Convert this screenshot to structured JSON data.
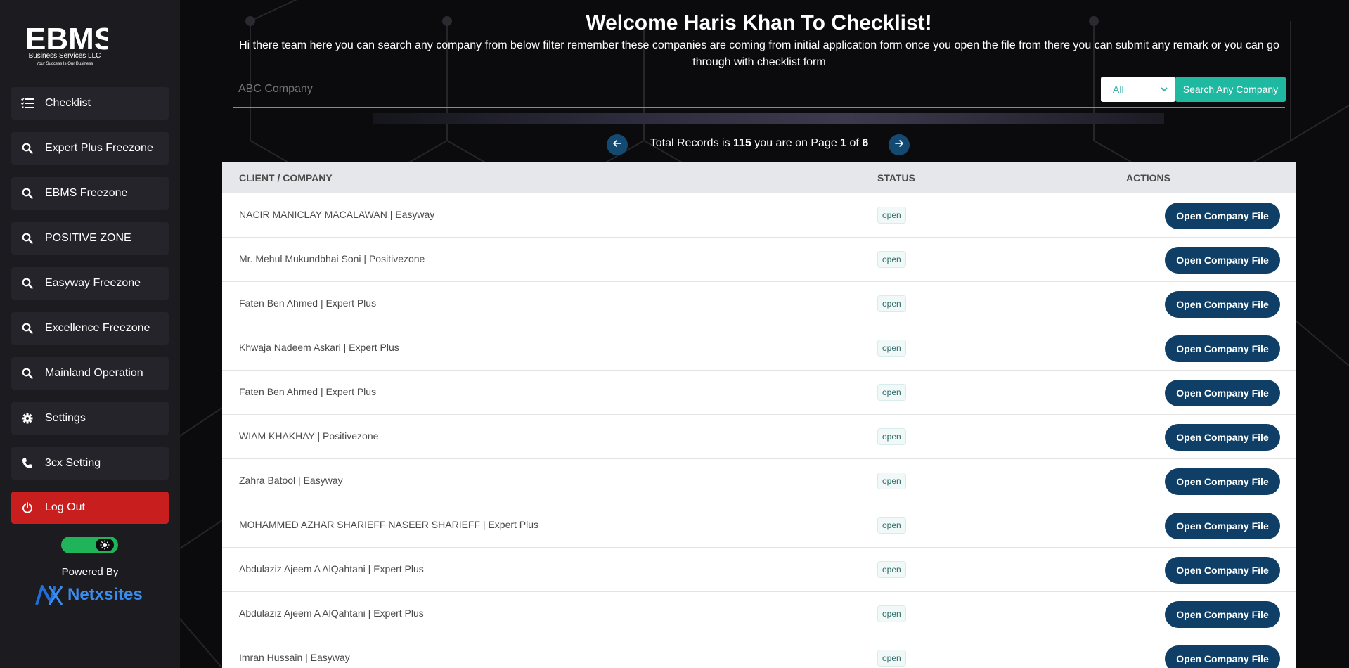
{
  "app": {
    "brand": "EBMS",
    "brand_sub": "Business Services LLC",
    "brand_tagline": "Your Success Is Our Business"
  },
  "sidebar": {
    "items": [
      {
        "label": "Checklist",
        "icon": "checklist-icon"
      },
      {
        "label": "Expert Plus Freezone",
        "icon": "search-icon"
      },
      {
        "label": "EBMS Freezone",
        "icon": "search-icon"
      },
      {
        "label": "POSITIVE ZONE",
        "icon": "search-icon"
      },
      {
        "label": "Easyway Freezone",
        "icon": "search-icon"
      },
      {
        "label": "Excellence Freezone",
        "icon": "search-icon"
      },
      {
        "label": "Mainland Operation",
        "icon": "search-icon"
      },
      {
        "label": "Settings",
        "icon": "gear-icon"
      },
      {
        "label": "3cx Setting",
        "icon": "phone-icon"
      }
    ],
    "logout_label": "Log Out",
    "powered_by": "Powered By",
    "powered_brand": "Netxsites"
  },
  "header": {
    "title": "Welcome Haris Khan To Checklist!",
    "subtitle": "Hi there team here you can search any company from below filter remember these companies are coming from initial application form once you open the file from there you can submit any remark or you can go through with checklist form"
  },
  "search": {
    "placeholder": "ABC Company",
    "filter_value": "All",
    "button_label": "Search Any Company"
  },
  "pagination": {
    "text_prefix": "Total Records is",
    "total": "115",
    "text_mid": "you are on Page",
    "page": "1",
    "text_of": "of",
    "pages": "6"
  },
  "table": {
    "headers": {
      "company": "CLIENT / COMPANY",
      "status": "STATUS",
      "actions": "ACTIONS"
    },
    "action_label": "Open Company File",
    "rows": [
      {
        "company": "NACIR MANICLAY MACALAWAN | Easyway",
        "status": "open"
      },
      {
        "company": "Mr. Mehul Mukundbhai Soni | Positivezone",
        "status": "open"
      },
      {
        "company": "Faten Ben Ahmed | Expert Plus",
        "status": "open"
      },
      {
        "company": "Khwaja Nadeem Askari | Expert Plus",
        "status": "open"
      },
      {
        "company": "Faten Ben Ahmed | Expert Plus",
        "status": "open"
      },
      {
        "company": "WIAM KHAKHAY | Positivezone",
        "status": "open"
      },
      {
        "company": "Zahra Batool | Easyway",
        "status": "open"
      },
      {
        "company": "MOHAMMED AZHAR SHARIEFF NASEER SHARIEFF | Expert Plus",
        "status": "open"
      },
      {
        "company": "Abdulaziz Ajeem A AlQahtani | Expert Plus",
        "status": "open"
      },
      {
        "company": "Abdulaziz Ajeem A AlQahtani | Expert Plus",
        "status": "open"
      },
      {
        "company": "Imran Hussain | Easyway",
        "status": "open"
      }
    ]
  },
  "colors": {
    "sidebar_bg": "#1c1c20",
    "nav_item_bg": "#24242a",
    "logout_bg": "#c81e1e",
    "accent_teal": "#1fb8a0",
    "action_button": "#0f3f66",
    "toggle_green": "#1fb45a"
  }
}
